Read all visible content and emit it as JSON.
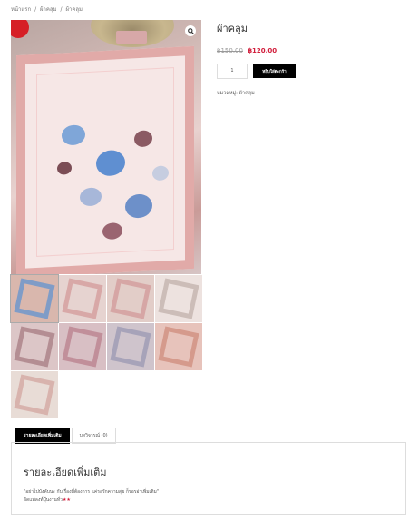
{
  "breadcrumb": [
    "หน้าแรก",
    "/",
    "ผ้าคลุม",
    "/",
    "ผ้าคลุม"
  ],
  "badge": "",
  "colors": {
    "accent": "#d11c3a",
    "button": "#000000",
    "badge": "#d61f26"
  },
  "product": {
    "title": "ผ้าคลุม",
    "old_price": "฿150.00",
    "price": "฿120.00",
    "quantity": "1",
    "add_to_cart": "หยิบใส่ตะกร้า",
    "category_label": "หมวดหมู่:",
    "category": "ผ้าคลุม"
  },
  "tabs": [
    {
      "label": "รายละเอียดเพิ่มเติม",
      "active": true
    },
    {
      "label": "บทวิจารณ์ (0)",
      "active": false
    }
  ],
  "description": {
    "heading": "รายละเอียดเพิ่มเติม",
    "line1": "\"อย่าไปบังคับนะ กับเรื่องที่ต้องการ แค่รอรักความสุข ก็รอรอ่าเพิ่มเติม\"",
    "line2": "อัดแพลงท์ปุ๊นงานทั่ว",
    "stars": "★★"
  },
  "icons": {
    "zoom": "search-icon"
  }
}
